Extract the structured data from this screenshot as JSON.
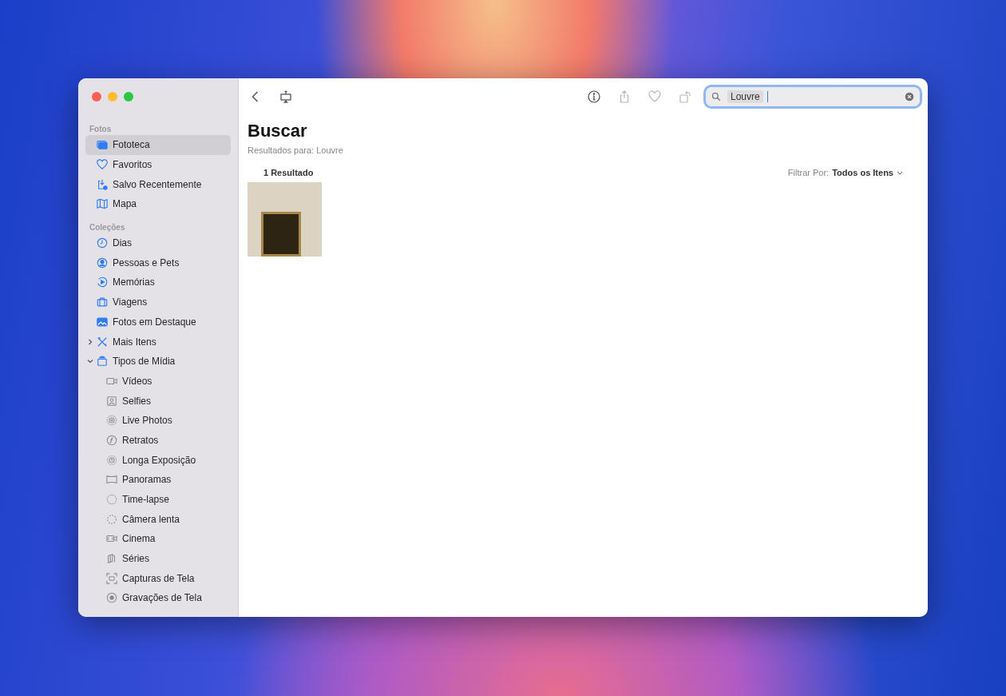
{
  "sidebar": {
    "sections": [
      {
        "title": "Fotos",
        "items": [
          {
            "label": "Fototeca",
            "selected": true
          },
          {
            "label": "Favoritos",
            "selected": false
          },
          {
            "label": "Salvo Recentemente",
            "selected": false
          },
          {
            "label": "Mapa",
            "selected": false
          }
        ]
      },
      {
        "title": "Coleções",
        "items": [
          {
            "label": "Dias",
            "selected": false
          },
          {
            "label": "Pessoas e Pets",
            "selected": false
          },
          {
            "label": "Memórias",
            "selected": false
          },
          {
            "label": "Viagens",
            "selected": false
          },
          {
            "label": "Fotos em Destaque",
            "selected": false
          },
          {
            "label": "Mais Itens",
            "selected": false,
            "expanded": false
          },
          {
            "label": "Tipos de Mídia",
            "selected": false,
            "expanded": true,
            "children": [
              {
                "label": "Vídeos",
                "selected": false
              },
              {
                "label": "Selfies",
                "selected": false
              },
              {
                "label": "Live Photos",
                "selected": false
              },
              {
                "label": "Retratos",
                "selected": false
              },
              {
                "label": "Longa Exposição",
                "selected": false
              },
              {
                "label": "Panoramas",
                "selected": false
              },
              {
                "label": "Time-lapse",
                "selected": false
              },
              {
                "label": "Câmera lenta",
                "selected": false
              },
              {
                "label": "Cinema",
                "selected": false
              },
              {
                "label": "Séries",
                "selected": false
              },
              {
                "label": "Capturas de Tela",
                "selected": false
              },
              {
                "label": "Gravações de Tela",
                "selected": false
              }
            ]
          }
        ]
      }
    ]
  },
  "toolbar": {
    "buttons": [
      {
        "disabled": false
      },
      {
        "disabled": true
      },
      {
        "disabled": true
      },
      {
        "disabled": true
      }
    ],
    "search": {
      "value": "Louvre",
      "focused": true
    }
  },
  "content": {
    "title": "Buscar",
    "subtitle": "Resultados para: Louvre",
    "count": "1 Resultado",
    "filter_label": "Filtrar Por:",
    "filter_value": "Todos os Itens"
  }
}
